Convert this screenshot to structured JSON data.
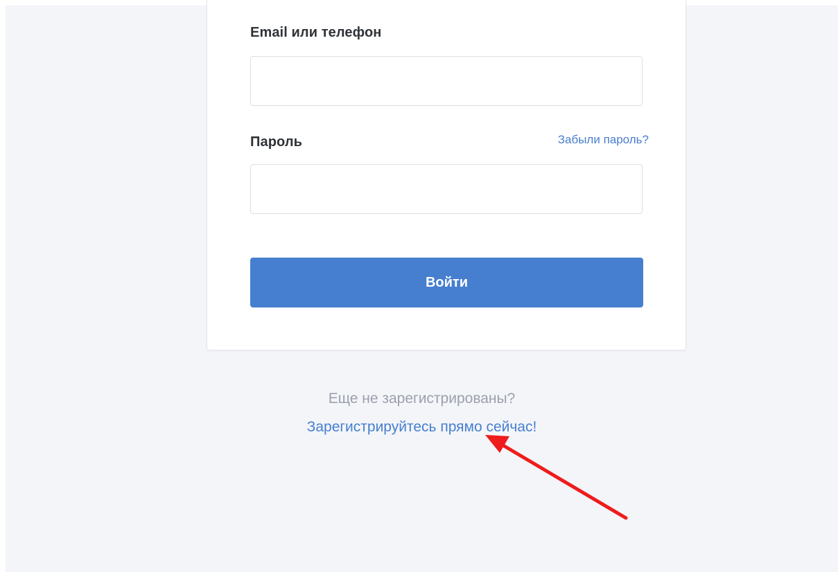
{
  "login_form": {
    "email_label": "Email или телефон",
    "email_value": "",
    "email_placeholder": "",
    "password_label": "Пароль",
    "forgot_password_link": "Забыли пароль?",
    "password_value": "",
    "password_placeholder": "",
    "submit_label": "Войти"
  },
  "registration": {
    "prompt": "Еще не зарегистрированы?",
    "link": "Зарегистрируйтесь прямо сейчас!"
  },
  "colors": {
    "accent": "#467fcf",
    "background": "#f4f5f9",
    "annotation_arrow": "#ee1c1c"
  },
  "annotation": {
    "icon": "red-arrow-icon"
  }
}
